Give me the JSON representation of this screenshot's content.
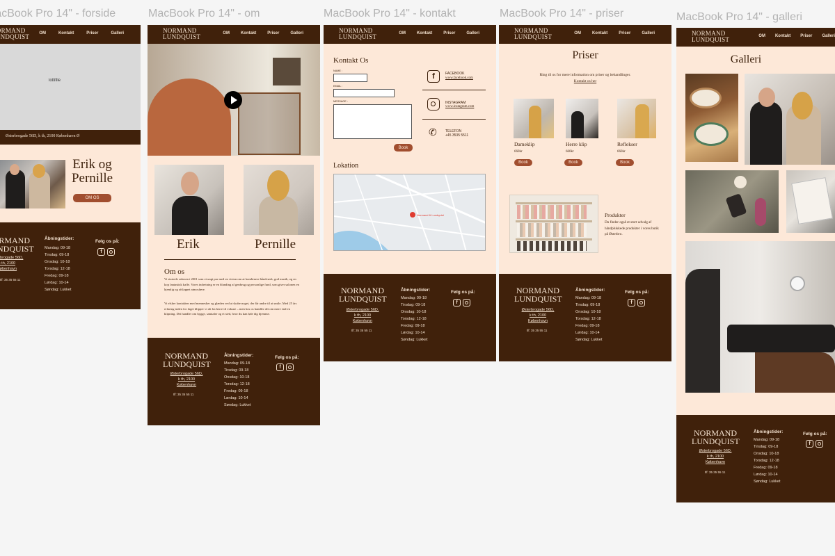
{
  "frames": [
    {
      "title": "MacBook Pro 14\" - forside"
    },
    {
      "title": "MacBook Pro 14\" - om"
    },
    {
      "title": "MacBook Pro 14\" - kontakt"
    },
    {
      "title": "MacBook Pro 14\" - priser"
    },
    {
      "title": "MacBook Pro 14\" - galleri"
    }
  ],
  "brand": {
    "logo_line1": "NORMAND",
    "logo_line2": "LUNDQUIST"
  },
  "nav": {
    "om": "OM",
    "kontakt": "Kontakt",
    "priser": "Priser",
    "galleri": "Galleri"
  },
  "forside": {
    "lottie": "lottifile",
    "address_bar": "Østerbrogade 56D, k th, 2100 København Ø",
    "heading_line1": "Erik og",
    "heading_line2": "Pernille",
    "om_button": "OM OS"
  },
  "om": {
    "name1": "Erik",
    "name2": "Pernille",
    "about_title": "Om os",
    "para1": "Vi startede salonen i 2001 som et ungt par med en vision om at kombinere håndværk, god musik, og en kop fantastisk kaffe. Vores indretning er en blanding af genbrug og personlige fund, som giver salonen en hjemlig og afslappet atmosfære.",
    "para2": "Vi elsker kontakten med mennesker og glæden ved at skabe noget, der får andre til at smile. Med 25 års erfaring inden for faget klipper vi alt fra herre til voksne – men hos os handler det om mere end en klipning. Det handler om hygge, samtaler og et sted, hvor du kan føle dig hjemme."
  },
  "kontakt": {
    "title": "Kontakt Os",
    "name_label": "NAME :",
    "email_label": "EMAIL :",
    "message_label": "MESSAGE :",
    "book_button": "Book",
    "facebook_label": "FACEBOOK",
    "facebook_link": "www.facebook.com",
    "instagram_label": "INSTAGRAM",
    "instagram_link": "www.instagram.com",
    "telefon_label": "TELEFON",
    "telefon_value": "+45 3535 5511",
    "lokation_title": "Lokation",
    "map_label": "Normand & Lundquist"
  },
  "priser": {
    "title": "Priser",
    "intro": "Ring til os for mere information om priser og behandlinger.",
    "contact_link": "Kontakt os her",
    "services": [
      {
        "name": "Dameklip",
        "price": "660kr",
        "button": "Book"
      },
      {
        "name": "Herre klip",
        "price": "660kr",
        "button": "Book"
      },
      {
        "name": "Reflekser",
        "price": "660kr",
        "button": "Book"
      }
    ],
    "products_title": "Produkter",
    "products_text": "Du finder også et stort udvalg af håndplukkede produkter i vores butik på Østerbro."
  },
  "galleri": {
    "title": "Galleri"
  },
  "footer": {
    "address_line1": "Østerbrogade 56D,",
    "address_line2": "k th, 2100",
    "address_line3": "København",
    "tlf": "tlf: 35 35 55 11",
    "hours_title": "Åbningstider:",
    "hours": [
      "Mandag: 09-18",
      "Tirsdag: 09-18",
      "Onsdag: 10-18",
      "Torsdag: 12-18",
      "Fredag: 09-18",
      "Lørdag: 10-14",
      "Søndag: Lukket"
    ],
    "follow": "Følg os på:"
  },
  "colors": {
    "dark_brown": "#40210b",
    "peach": "#fde8d8",
    "button_brown": "#a14e2f"
  }
}
